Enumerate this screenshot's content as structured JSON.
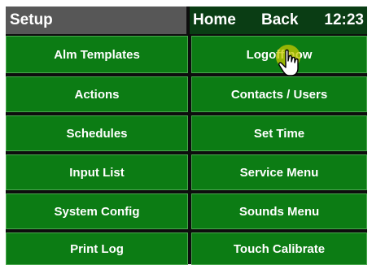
{
  "header": {
    "title": "Setup",
    "home_label": "Home",
    "back_label": "Back",
    "clock": "12:23"
  },
  "menu": {
    "left": [
      {
        "label": "Alm Templates"
      },
      {
        "label": "Actions"
      },
      {
        "label": "Schedules"
      },
      {
        "label": "Input List"
      },
      {
        "label": "System Config"
      },
      {
        "label": "Print Log"
      }
    ],
    "right": [
      {
        "label": "Logoff now"
      },
      {
        "label": "Contacts / Users"
      },
      {
        "label": "Set Time"
      },
      {
        "label": "Service Menu"
      },
      {
        "label": "Sounds Menu"
      },
      {
        "label": "Touch Calibrate"
      }
    ]
  },
  "colors": {
    "button_green": "#0c7c14",
    "title_gray": "#575757",
    "nav_dark_green": "#0a3d14",
    "pointer_highlight": "#c8c800"
  },
  "pointer": {
    "icon": "hand-pointer-icon"
  }
}
